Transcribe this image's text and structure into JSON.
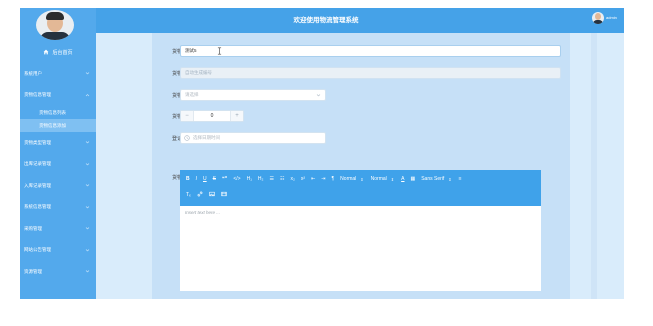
{
  "sidebar": {
    "home_label": "后台首页",
    "items": [
      {
        "label": "系统用户",
        "expandable": true
      },
      {
        "label": "货物信息管理",
        "expandable": true
      },
      {
        "label": "货物信息列表",
        "expandable": false,
        "sub": true
      },
      {
        "label": "货物信息添加",
        "expandable": false,
        "sub": true,
        "active": true
      },
      {
        "label": "货物类型管理",
        "expandable": true
      },
      {
        "label": "出库记录管理",
        "expandable": true
      },
      {
        "label": "入库记录管理",
        "expandable": true
      },
      {
        "label": "系统信息管理",
        "expandable": true
      },
      {
        "label": "采购管理",
        "expandable": true
      },
      {
        "label": "网站公告管理",
        "expandable": true
      },
      {
        "label": "资源管理",
        "expandable": true
      }
    ]
  },
  "header": {
    "title": "欢迎使用物流管理系统",
    "username": "admin"
  },
  "form": {
    "name": {
      "label": "货物名称",
      "value": "测试5"
    },
    "number": {
      "label": "货物编号",
      "placeholder": "自动生成编号"
    },
    "type": {
      "label": "货物类型",
      "placeholder": "请选择"
    },
    "quantity": {
      "label": "货物数量",
      "value": "0",
      "minus": "−",
      "plus": "+"
    },
    "date": {
      "label": "登记时间",
      "placeholder": "选择日期时间"
    },
    "detail": {
      "label": "货物详情"
    }
  },
  "editor": {
    "toolbar_row1": [
      "B",
      "I",
      "U",
      "S",
      "❝❞",
      "</>",
      "H₁",
      "H₂",
      "☰",
      "☷",
      "x₂",
      "x²",
      "⇤",
      "⇥",
      "¶",
      "Normal",
      "Normal",
      "A",
      "▦",
      "Sans Serif",
      "≡"
    ],
    "toolbar_row2": [
      "Tₓ",
      "🔗",
      "▣",
      "▤"
    ],
    "dropdowns": {
      "size": "Normal",
      "header": "Normal",
      "font": "Sans Serif"
    },
    "placeholder": "Insert text here ..."
  },
  "colors": {
    "sidebar": "#53a9ec",
    "topbar": "#45a2e8",
    "toolbar": "#3fa2ea",
    "background": "#d9ecfb"
  }
}
